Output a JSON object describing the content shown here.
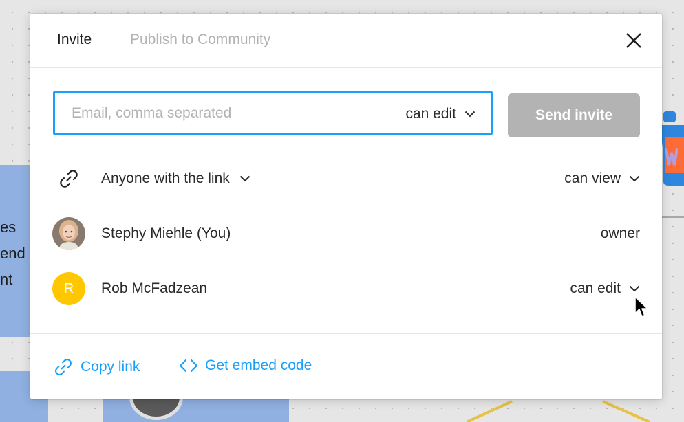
{
  "tabs": {
    "invite": "Invite",
    "publish": "Publish to Community"
  },
  "invite_form": {
    "email_placeholder": "Email, comma separated",
    "email_value": "",
    "permission": "can edit",
    "send_label": "Send invite"
  },
  "link_access": {
    "label": "Anyone with the link",
    "permission": "can view",
    "icon": "link-icon"
  },
  "members": [
    {
      "name": "Stephy Miehle (You)",
      "role": "owner",
      "avatar": "photo"
    },
    {
      "name": "Rob McFadzean",
      "role": "can edit",
      "avatar_initial": "R",
      "avatar_color": "#FFC700"
    }
  ],
  "footer": {
    "copy_link": "Copy link",
    "embed_code": "Get embed code"
  },
  "background": {
    "text_fragment": "es\nend\nnt"
  },
  "colors": {
    "accent": "#18A0FB",
    "disabled_button": "#B3B3B3",
    "inactive_tab": "#B3B3B3"
  }
}
